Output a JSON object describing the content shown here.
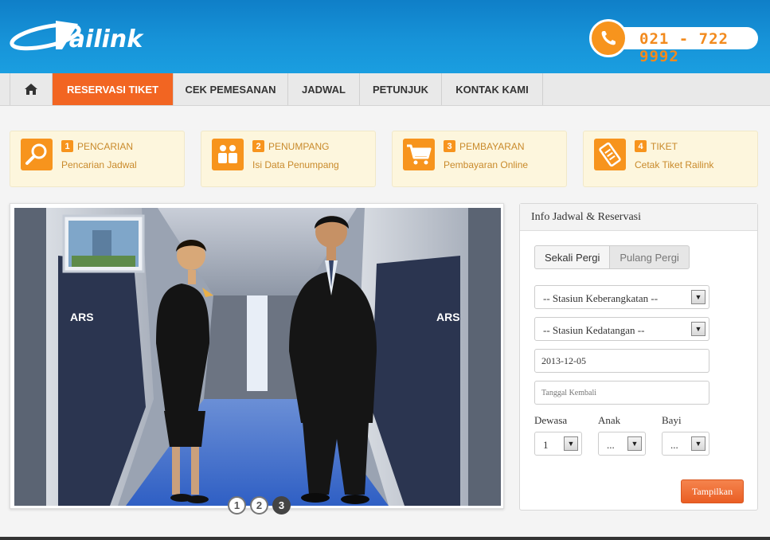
{
  "header": {
    "logo_text": "railink",
    "phone": "021 - 722 9992",
    "colors": {
      "header_blue": "#1793d8",
      "accent_orange": "#f7941d"
    }
  },
  "nav": {
    "home_icon": "home-icon",
    "items": [
      {
        "label": "RESERVASI TIKET",
        "active": true
      },
      {
        "label": "CEK PEMESANAN",
        "active": false
      },
      {
        "label": "JADWAL",
        "active": false
      },
      {
        "label": "PETUNJUK",
        "active": false
      },
      {
        "label": "KONTAK KAMI",
        "active": false
      }
    ]
  },
  "steps": [
    {
      "num": "1",
      "title": "PENCARIAN",
      "sub": "Pencarian Jadwal",
      "icon": "search-icon"
    },
    {
      "num": "2",
      "title": "PENUMPANG",
      "sub": "Isi Data Penumpang",
      "icon": "passengers-icon"
    },
    {
      "num": "3",
      "title": "PEMBAYARAN",
      "sub": "Pembayaran Online",
      "icon": "cart-icon"
    },
    {
      "num": "4",
      "title": "TIKET",
      "sub": "Cetak Tiket Railink",
      "icon": "ticket-icon"
    }
  ],
  "slider": {
    "dots": [
      "1",
      "2",
      "3"
    ],
    "active_dot": 3
  },
  "panel": {
    "title": "Info Jadwal & Reservasi",
    "trip_types": [
      "Sekali Pergi",
      "Pulang Pergi"
    ],
    "departure_station": "-- Stasiun Keberangkatan --",
    "arrival_station": "-- Stasiun Kedatangan --",
    "departure_date": "2013-12-05",
    "return_date_placeholder": "Tanggal Kembali",
    "adult_label": "Dewasa",
    "child_label": "Anak",
    "infant_label": "Bayi",
    "adult_value": "1",
    "child_value": "...",
    "infant_value": "...",
    "submit": "Tampilkan"
  }
}
